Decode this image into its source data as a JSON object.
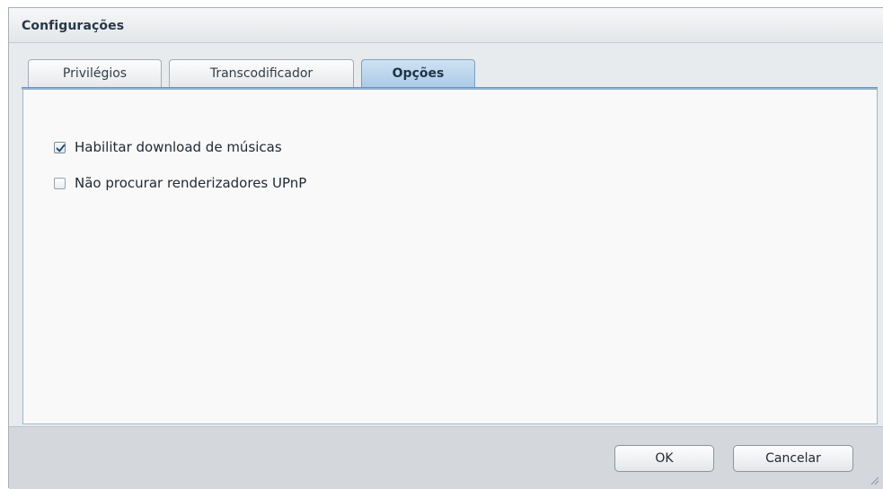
{
  "window": {
    "title": "Configurações"
  },
  "tabs": [
    {
      "label": "Privilégios",
      "active": false
    },
    {
      "label": "Transcodificador",
      "active": false
    },
    {
      "label": "Opções",
      "active": true
    }
  ],
  "options": [
    {
      "label": "Habilitar download de músicas",
      "checked": true
    },
    {
      "label": "Não procurar renderizadores UPnP",
      "checked": false
    }
  ],
  "footer": {
    "ok_label": "OK",
    "cancel_label": "Cancelar"
  },
  "colors": {
    "active_tab": "#a9c9e6",
    "accent_border": "#8fb1d3"
  }
}
